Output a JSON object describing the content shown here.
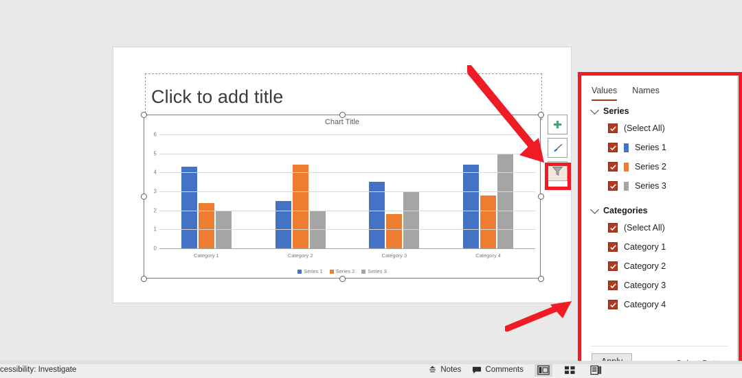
{
  "slide": {
    "title_placeholder": "Click to add title"
  },
  "chart": {
    "title": "Chart Title",
    "elements_button": "chart-elements",
    "styles_button": "chart-styles",
    "filters_button": "chart-filters"
  },
  "chart_data": {
    "type": "bar",
    "title": "Chart Title",
    "categories": [
      "Category 1",
      "Category 2",
      "Category 3",
      "Category 4"
    ],
    "series": [
      {
        "name": "Series 1",
        "color": "#4472C4",
        "values": [
          4.3,
          2.5,
          3.5,
          4.4
        ]
      },
      {
        "name": "Series 2",
        "color": "#ED7D31",
        "values": [
          2.4,
          4.4,
          1.8,
          2.8
        ]
      },
      {
        "name": "Series 3",
        "color": "#A5A5A5",
        "values": [
          2.0,
          2.0,
          3.0,
          5.0
        ]
      }
    ],
    "xlabel": "",
    "ylabel": "",
    "ylim": [
      0,
      6
    ],
    "yticks": [
      0,
      1,
      2,
      3,
      4,
      5,
      6
    ],
    "grid": true,
    "legend": "bottom"
  },
  "pane": {
    "tabs": [
      {
        "label": "Values",
        "active": true
      },
      {
        "label": "Names",
        "active": false
      }
    ],
    "groups": [
      {
        "title": "Series",
        "rows": [
          {
            "label": "(Select All)",
            "checked": true,
            "swatch": null
          },
          {
            "label": "Series 1",
            "checked": true,
            "swatch": "#4472C4"
          },
          {
            "label": "Series 2",
            "checked": true,
            "swatch": "#ED7D31"
          },
          {
            "label": "Series 3",
            "checked": true,
            "swatch": "#A5A5A5"
          }
        ]
      },
      {
        "title": "Categories",
        "rows": [
          {
            "label": "(Select All)",
            "checked": true,
            "swatch": null
          },
          {
            "label": "Category 1",
            "checked": true,
            "swatch": null
          },
          {
            "label": "Category 2",
            "checked": true,
            "swatch": null
          },
          {
            "label": "Category 3",
            "checked": true,
            "swatch": null
          },
          {
            "label": "Category 4",
            "checked": true,
            "swatch": null
          }
        ]
      }
    ],
    "apply_label": "Apply",
    "select_data_label": "Select Data..."
  },
  "statusbar": {
    "accessibility": "cessibility: Investigate",
    "notes": "Notes",
    "comments": "Comments"
  },
  "colors": {
    "annotation_red": "#EE1C25",
    "accent_red": "#B33A1E",
    "series1": "#4472C4",
    "series2": "#ED7D31",
    "series3": "#A5A5A5"
  }
}
